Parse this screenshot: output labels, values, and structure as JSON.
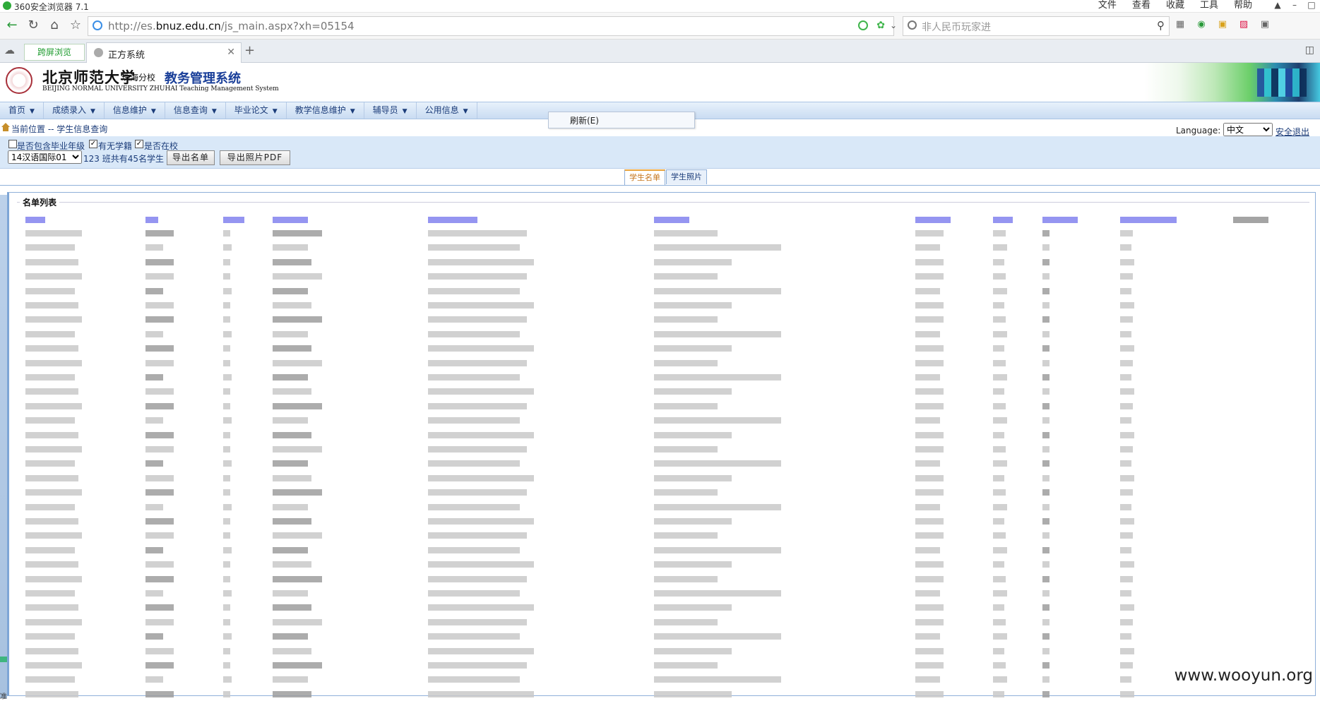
{
  "browser": {
    "title": "360安全浏览器 7.1",
    "menus": [
      "文件",
      "查看",
      "收藏",
      "工具",
      "帮助"
    ],
    "url_prefix": "http://es.",
    "url_domain": "bnuz.edu.cn",
    "url_path": "/js_main.aspx?xh=05154",
    "search_placeholder": "非人民币玩家进",
    "tabs": [
      {
        "label": "跨屏浏览"
      },
      {
        "label": "正方系统"
      }
    ]
  },
  "header": {
    "school_name": "北京师范大学",
    "campus": "珠海分校",
    "system_title": "教务管理系统",
    "english_name": "BEIJING NORMAL UNIVERSITY ZHUHAI Teaching Management System"
  },
  "menu": {
    "items": [
      "首页",
      "成绩录入",
      "信息维护",
      "信息查询",
      "毕业论文",
      "教学信息维护",
      "辅导员",
      "公用信息"
    ],
    "context_menu_item": "刷新(E)"
  },
  "location": {
    "text": "当前位置 -- 学生信息查询",
    "language_label": "Language:",
    "language_value": "中文",
    "logout": "安全退出"
  },
  "filters": {
    "include_grad_label": "是否包含毕业年级",
    "include_grad_checked": false,
    "has_status_label": "有无学籍",
    "has_status_checked": true,
    "in_school_label": "是否在校",
    "in_school_checked": true,
    "class_value": "14汉语国际01",
    "class_count_text": "123 班共有45名学生",
    "export_list": "导出名单",
    "export_photo_pdf": "导出照片PDF"
  },
  "tabs": {
    "student_list": "学生名单",
    "student_photos": "学生照片"
  },
  "list": {
    "legend": "名单列表",
    "row_count": 33
  },
  "watermark": "www.wooyun.org",
  "status_char": "准"
}
